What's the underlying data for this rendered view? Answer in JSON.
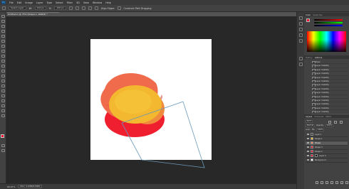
{
  "app": {
    "logo": "Ps"
  },
  "menu": [
    "File",
    "Edit",
    "Image",
    "Layer",
    "Type",
    "Select",
    "Filter",
    "3D",
    "View",
    "Window",
    "Help"
  ],
  "options_bar": {
    "layer_dropdown": "Select Layer",
    "fields": [
      "W:",
      "100 px",
      "H:",
      "100 px"
    ],
    "align_edges": "Align Edges",
    "constrain": "Constrain Path Dragging"
  },
  "document": {
    "tab_title": "Untitled-1 @ 75% (Shape 1, RGB/8) *"
  },
  "status": {
    "zoom": "66.67%",
    "info": "Doc: 1.43M/4.59M"
  },
  "panels": {
    "color_tabs": [
      "Color",
      "Swatches"
    ],
    "history_tabs": [
      "History",
      "Actions"
    ],
    "history_items": [
      "Open",
      "Layer Visibility",
      "Layer Visibility",
      "Layer Visibility",
      "Layer Visibility",
      "Layer Visibility",
      "Layer Visibility",
      "Layer Visibility",
      "Layer Visibility",
      "Layer Visibility",
      "Layer Visibility",
      "Layer Visibility",
      "Layer Visibility",
      "Layer Visibility",
      "Modify Ellipse"
    ],
    "layers_tabs": [
      "Layers",
      "Channels",
      "Paths"
    ],
    "layers_kind": "Kind",
    "blend_mode": "Normal",
    "opacity_label": "Opacity:",
    "opacity_value": "100%",
    "lock_label": "Lock:",
    "fill_label": "Fill:",
    "fill_value": "100%",
    "layers": [
      {
        "name": "Layer 1",
        "type": "folder"
      },
      {
        "name": "Shape 1",
        "type": "yellow"
      },
      {
        "name": "Shape",
        "type": "orange"
      },
      {
        "name": "Shape 3",
        "type": "red"
      },
      {
        "name": "Shape 2",
        "type": "red"
      },
      {
        "name": "Layer 2",
        "type": "red"
      },
      {
        "name": "Background",
        "type": "white"
      }
    ]
  },
  "colors": {
    "fg": "#e8112d",
    "bg": "#111111",
    "shape_red": "#f01f2f",
    "shape_orange": "#ef6b4b",
    "shape_yellow": "#f3b82f",
    "path": "#6a98b8"
  }
}
